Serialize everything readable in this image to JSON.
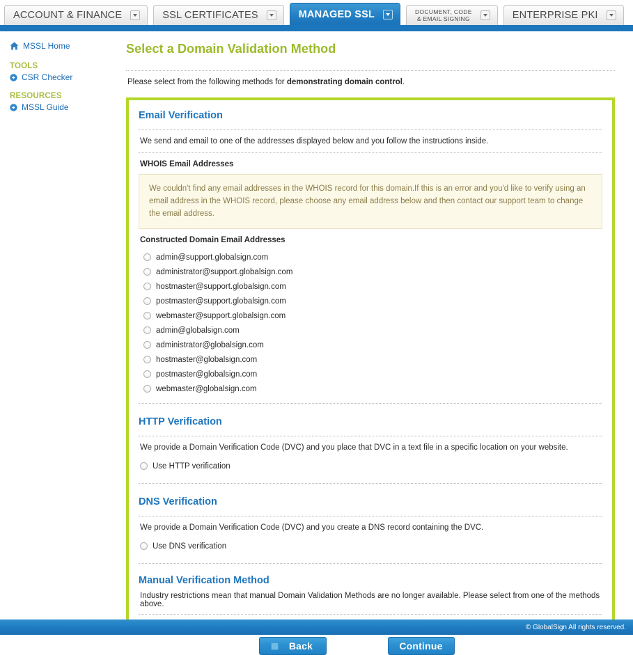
{
  "tabs": [
    {
      "label": "ACCOUNT & FINANCE",
      "active": false,
      "two_line": false
    },
    {
      "label": "SSL CERTIFICATES",
      "active": false,
      "two_line": false
    },
    {
      "label": "MANAGED SSL",
      "active": true,
      "two_line": false
    },
    {
      "label": "DOCUMENT, CODE\n& EMAIL SIGNING",
      "line1": "DOCUMENT, CODE",
      "line2": "& EMAIL SIGNING",
      "active": false,
      "two_line": true
    },
    {
      "label": "ENTERPRISE PKI",
      "active": false,
      "two_line": false
    }
  ],
  "sidebar": {
    "home_label": "MSSL Home",
    "groups": [
      {
        "title": "TOOLS",
        "items": [
          {
            "label": "CSR Checker"
          }
        ]
      },
      {
        "title": "RESOURCES",
        "items": [
          {
            "label": "MSSL Guide"
          }
        ]
      }
    ]
  },
  "main": {
    "page_title": "Select a Domain Validation Method",
    "intro_prefix": "Please select from the following methods for ",
    "intro_bold": "demonstrating domain control",
    "intro_suffix": "."
  },
  "email_section": {
    "title": "Email Verification",
    "description": "We send and email to one of the addresses displayed below and you follow the instructions inside.",
    "whois_label": "WHOIS Email Addresses",
    "notice": "We couldn't find any email addresses in the WHOIS record for this domain.If this is an error and you'd like to verify using an email address in the WHOIS record, please choose any email address below and then contact our support team to change the email address.",
    "constructed_label": "Constructed Domain Email Addresses",
    "addresses": [
      "admin@support.globalsign.com",
      "administrator@support.globalsign.com",
      "hostmaster@support.globalsign.com",
      "postmaster@support.globalsign.com",
      "webmaster@support.globalsign.com",
      "admin@globalsign.com",
      "administrator@globalsign.com",
      "hostmaster@globalsign.com",
      "postmaster@globalsign.com",
      "webmaster@globalsign.com"
    ]
  },
  "http_section": {
    "title": "HTTP Verification",
    "description": "We provide a Domain Verification Code (DVC) and you place that DVC in a text file in a specific location on your website.",
    "option_label": "Use HTTP verification"
  },
  "dns_section": {
    "title": "DNS Verification",
    "description": "We provide a Domain Verification Code (DVC) and you create a DNS record containing the DVC.",
    "option_label": "Use DNS verification"
  },
  "manual_section": {
    "title": "Manual Verification Method",
    "description": "Industry restrictions mean that manual Domain Validation Methods are no longer available. Please select from one of the methods above."
  },
  "buttons": {
    "back": "Back",
    "continue": "Continue"
  },
  "footer": {
    "copyright": "© GlobalSign All rights reserved."
  },
  "colors": {
    "brand_blue": "#1c76bc",
    "brand_green": "#b4d72b",
    "title_green": "#9cba29",
    "section_blue": "#1f76bd",
    "notice_bg": "#fdf9e8"
  }
}
